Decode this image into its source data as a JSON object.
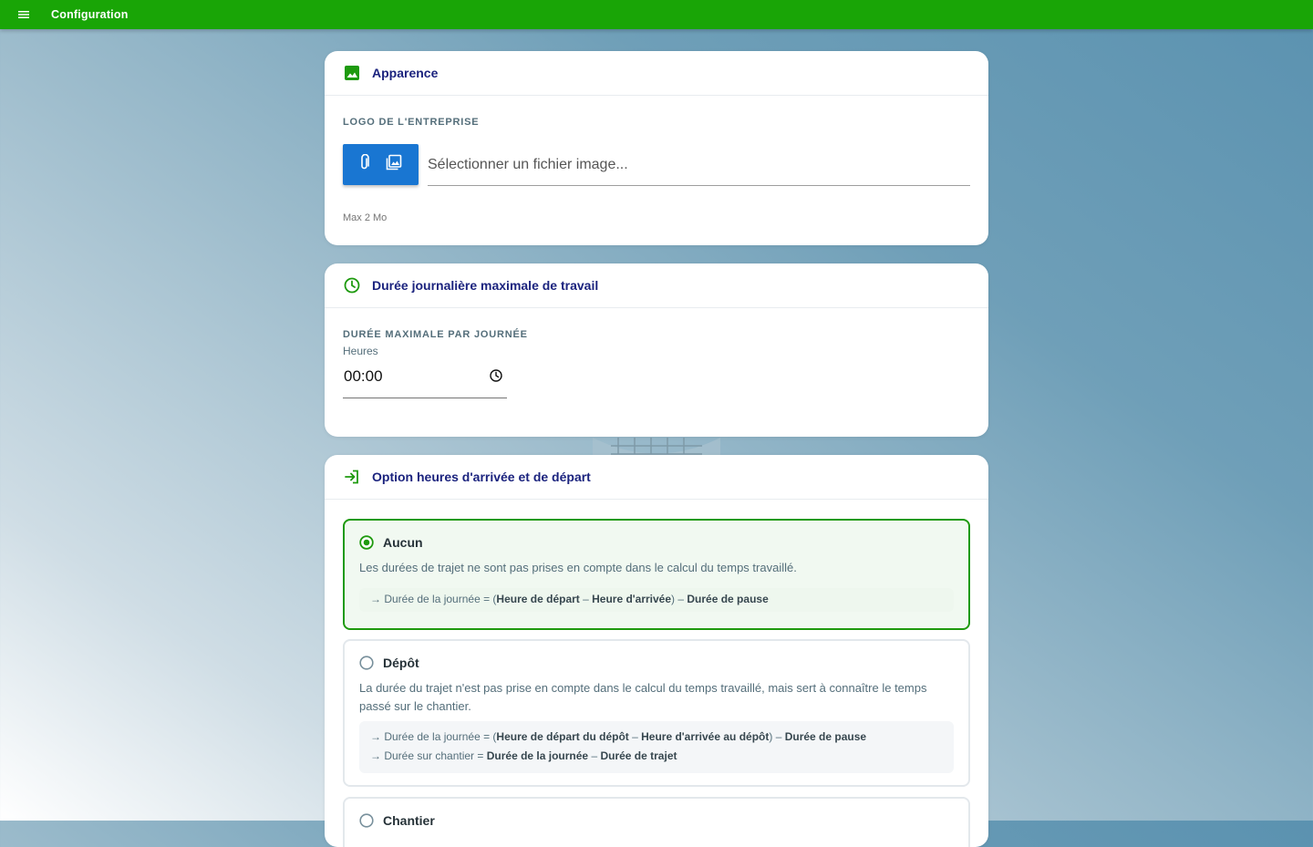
{
  "app": {
    "title": "Configuration",
    "colors": {
      "topbar": "#19a506",
      "accent_blue": "#1976d2",
      "title_navy": "#1b237e",
      "selected_green": "#1e9a0e"
    }
  },
  "appearance": {
    "title": "Apparence",
    "logo_label": "LOGO DE L'ENTREPRISE",
    "file_placeholder": "Sélectionner un fichier image...",
    "hint": "Max 2 Mo",
    "icons": [
      "image-icon",
      "paperclip-icon",
      "photo-library-icon"
    ]
  },
  "max_duration": {
    "title": "Durée journalière maximale de travail",
    "label": "DURÉE MAXIMALE PAR JOURNÉE",
    "sublabel": "Heures",
    "value": "00:00",
    "icons": [
      "clock-icon"
    ]
  },
  "arrival_departure": {
    "title": "Option heures d'arrivée et de départ",
    "selected": "Aucun",
    "options": [
      {
        "title": "Aucun",
        "description": "Les durées de trajet ne sont pas prises en compte dans le calcul du temps travaillé.",
        "f1_prefix": "→ Durée de la journée = (",
        "f1_b1": "Heure de départ",
        "f1_sep": " – ",
        "f1_b2": "Heure d'arrivée",
        "f1_mid": ") – ",
        "f1_b3": "Durée de pause"
      },
      {
        "title": "Dépôt",
        "description": "La durée du trajet n'est pas prise en compte dans le calcul du temps travaillé, mais sert à connaître le temps passé sur le chantier.",
        "f1_prefix": "→ Durée de la journée = (",
        "f1_b1": "Heure de départ du dépôt",
        "f1_sep": " – ",
        "f1_b2": "Heure d'arrivée au dépôt",
        "f1_mid": ") – ",
        "f1_b3": "Durée de pause",
        "f2_prefix": "→ Durée sur chantier = ",
        "f2_b1": "Durée de la journée",
        "f2_sep": " – ",
        "f2_b2": "Durée de trajet"
      },
      {
        "title": "Chantier"
      }
    ]
  }
}
